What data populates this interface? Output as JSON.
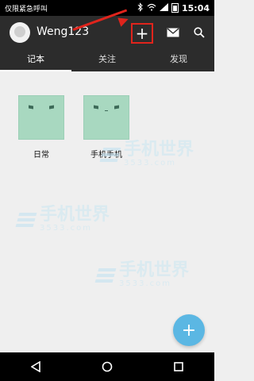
{
  "status_bar": {
    "carrier_text": "仅限紧急呼叫",
    "time": "15:04"
  },
  "app_bar": {
    "username": "Weng123",
    "add_icon": "+",
    "tabs": [
      {
        "label": "记本",
        "active": true
      },
      {
        "label": "关注",
        "active": false
      },
      {
        "label": "发现",
        "active": false
      }
    ]
  },
  "notebooks": [
    {
      "title": "日常"
    },
    {
      "title": "手机手机"
    }
  ],
  "watermarks": [
    {
      "text": "手机世界",
      "sub": "3533.com"
    },
    {
      "text": "手机世界",
      "sub": "3533.com"
    },
    {
      "text": "手机世界",
      "sub": "3533.com"
    }
  ],
  "fab_icon": "+",
  "colors": {
    "appbar": "#2c2c2c",
    "accent_red": "#e0241c",
    "fab": "#5bb7e3",
    "notebook_cover": "#a8d8c0"
  }
}
